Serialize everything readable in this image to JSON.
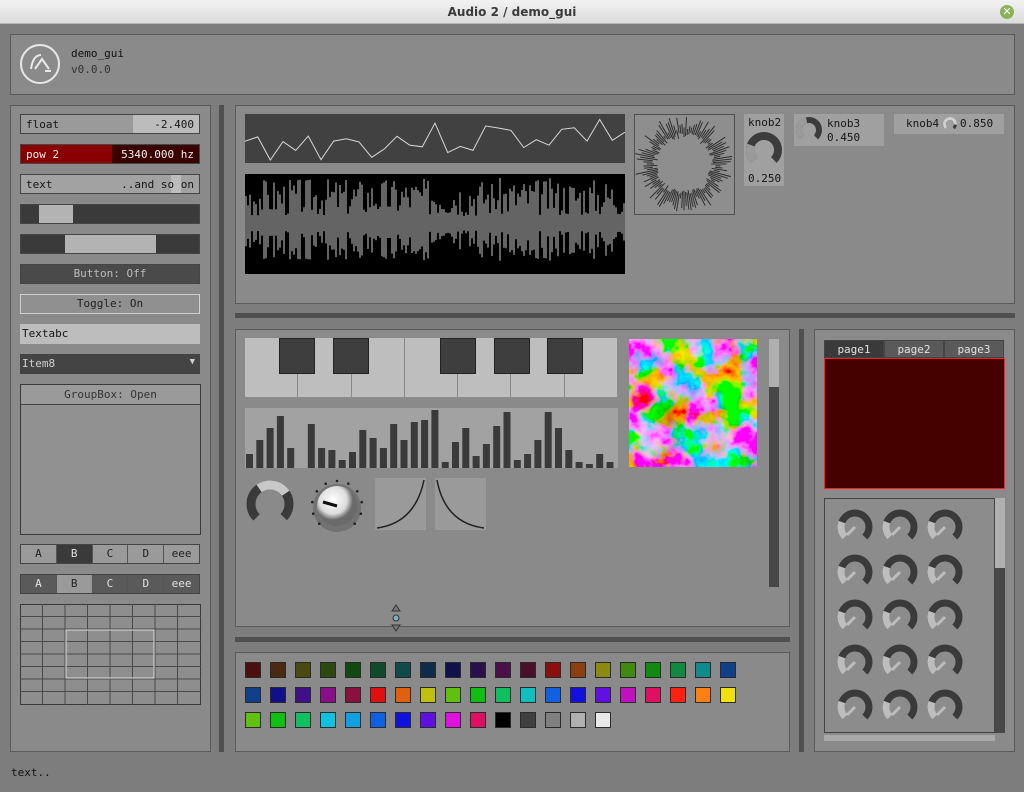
{
  "window": {
    "title": "Audio 2 / demo_gui"
  },
  "header": {
    "app_name": "demo_gui",
    "version": "v0.0.0"
  },
  "left": {
    "float": {
      "label": "float",
      "value": "-2.400",
      "fill": 0.63
    },
    "pow2": {
      "label": "pow 2",
      "value": "5340.000 hz",
      "fill": 0.51
    },
    "text": {
      "label": "text",
      "value": "..and so on"
    },
    "range1": {
      "lo": 0.1,
      "hi": 0.3
    },
    "range2": {
      "lo": 0.25,
      "hi": 0.75
    },
    "button_label": "Button: Off",
    "toggle_label": "Toggle: On",
    "text_input": "Textabc",
    "dropdown_value": "Item8",
    "groupbox_label": "GroupBox: Open",
    "seg1": [
      "A",
      "B",
      "C",
      "D",
      "eee"
    ],
    "seg1_selected": 1,
    "seg2": [
      "A",
      "B",
      "C",
      "D",
      "eee"
    ],
    "seg2_selected": 1
  },
  "knobs_top": {
    "knob2": {
      "label": "knob2",
      "value": "0.250"
    },
    "knob3": {
      "label": "knob3",
      "value": "0.450"
    },
    "knob4": {
      "label": "knob4",
      "value": "0.850"
    }
  },
  "tabs": {
    "items": [
      "page1",
      "page2",
      "page3"
    ],
    "selected": 0
  },
  "palette": {
    "row1": [
      "#4a1010",
      "#4a2a10",
      "#4a4a10",
      "#2a4a10",
      "#104a10",
      "#104a2a",
      "#104a4a",
      "#102a4a",
      "#10104a",
      "#2a104a",
      "#4a104a",
      "#4a102a",
      "#8a1010",
      "#8a4010",
      "#8a8a10",
      "#408a10",
      "#108a10",
      "#108a40",
      "#108a8a",
      "#10408a"
    ],
    "row2": [
      "#10408a",
      "#10108a",
      "#40108a",
      "#8a108a",
      "#8a1040",
      "#e01010",
      "#e06010",
      "#c0c010",
      "#60c010",
      "#10c010",
      "#10c060",
      "#10c0c0",
      "#1060e0",
      "#1010e0",
      "#6010e0",
      "#c010c0",
      "#e01060",
      "#ff2010",
      "#ff8010",
      "#f0e010"
    ],
    "row3": [
      "#60c010",
      "#10c010",
      "#10c060",
      "#10c0e0",
      "#10a0e0",
      "#1060e0",
      "#1010e0",
      "#6010e0",
      "#e010e0",
      "#e01060",
      "#000000",
      "#404040",
      "#808080",
      "#b0b0b0",
      "#e8e8e8"
    ]
  },
  "status": {
    "text": "text.."
  }
}
